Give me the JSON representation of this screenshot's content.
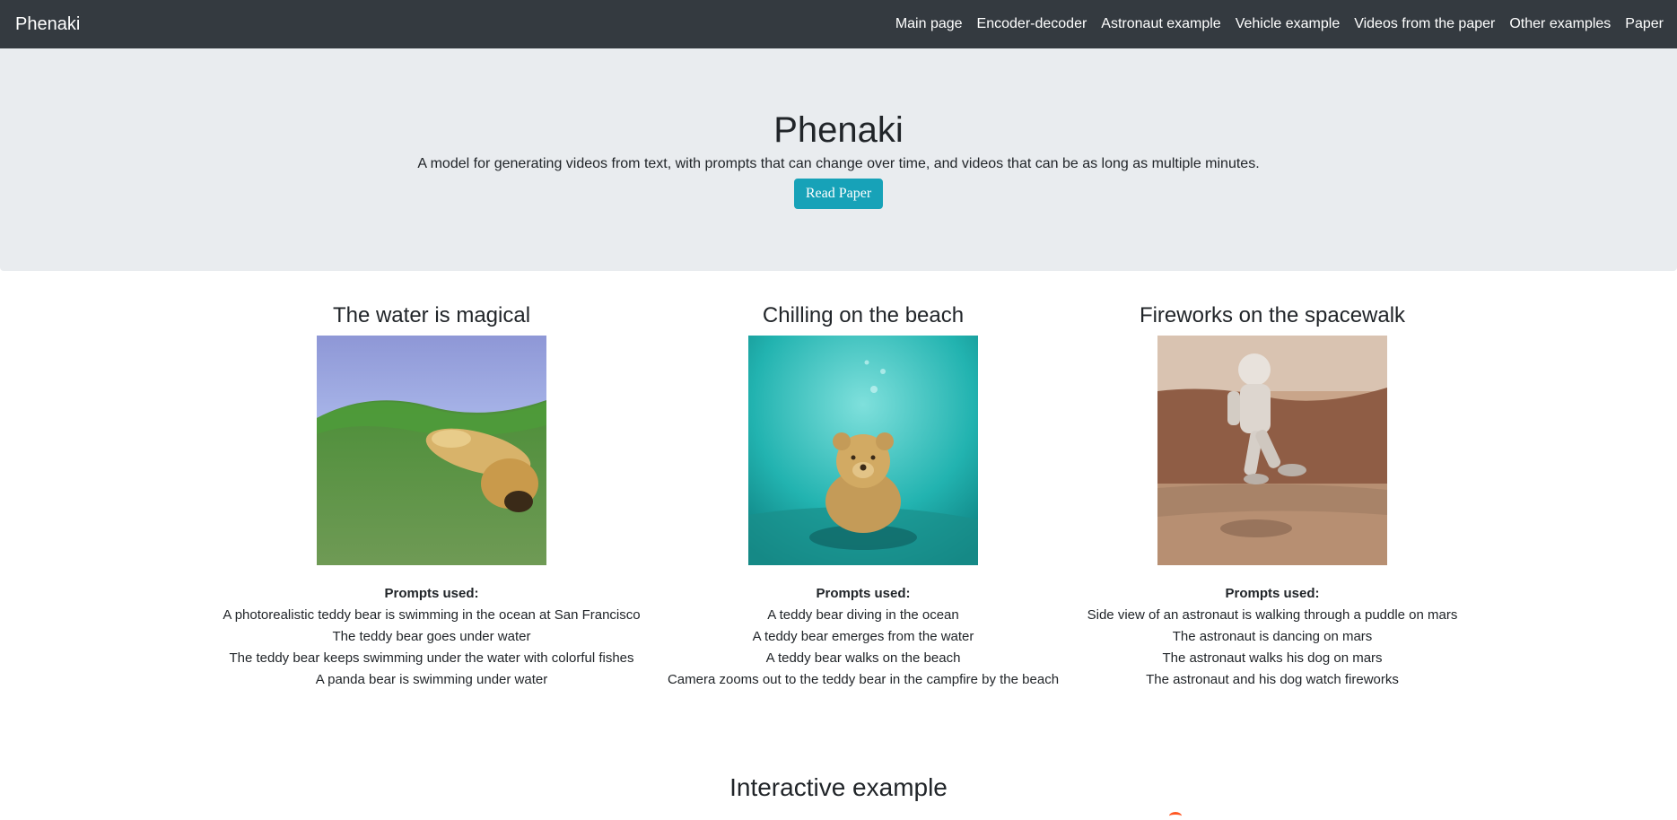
{
  "navbar": {
    "brand": "Phenaki",
    "links": [
      "Main page",
      "Encoder-decoder",
      "Astronaut example",
      "Vehicle example",
      "Videos from the paper",
      "Other examples",
      "Paper"
    ]
  },
  "hero": {
    "title": "Phenaki",
    "subtitle": "A model for generating videos from text, with prompts that can change over time, and videos that can be as long as multiple minutes.",
    "button_label": "Read Paper"
  },
  "examples": [
    {
      "title": "The water is magical",
      "prompts_label": "Prompts used:",
      "prompts": [
        "A photorealistic teddy bear is swimming in the ocean at San Francisco",
        "The teddy bear goes under water",
        "The teddy bear keeps swimming under the water with colorful fishes",
        "A panda bear is swimming under water"
      ]
    },
    {
      "title": "Chilling on the beach",
      "prompts_label": "Prompts used:",
      "prompts": [
        "A teddy bear diving in the ocean",
        "A teddy bear emerges from the water",
        "A teddy bear walks on the beach",
        "Camera zooms out to the teddy bear in the campfire by the beach"
      ]
    },
    {
      "title": "Fireworks on the spacewalk",
      "prompts_label": "Prompts used:",
      "prompts": [
        "Side view of an astronaut is walking through a puddle on mars",
        "The astronaut is dancing on mars",
        "The astronaut walks his dog on mars",
        "The astronaut and his dog watch fireworks"
      ]
    }
  ],
  "interactive": {
    "title": "Interactive example"
  },
  "colors": {
    "navbar_bg": "#343a40",
    "hero_bg": "#e9ecef",
    "button_bg": "#17a2b8",
    "text": "#212529"
  }
}
